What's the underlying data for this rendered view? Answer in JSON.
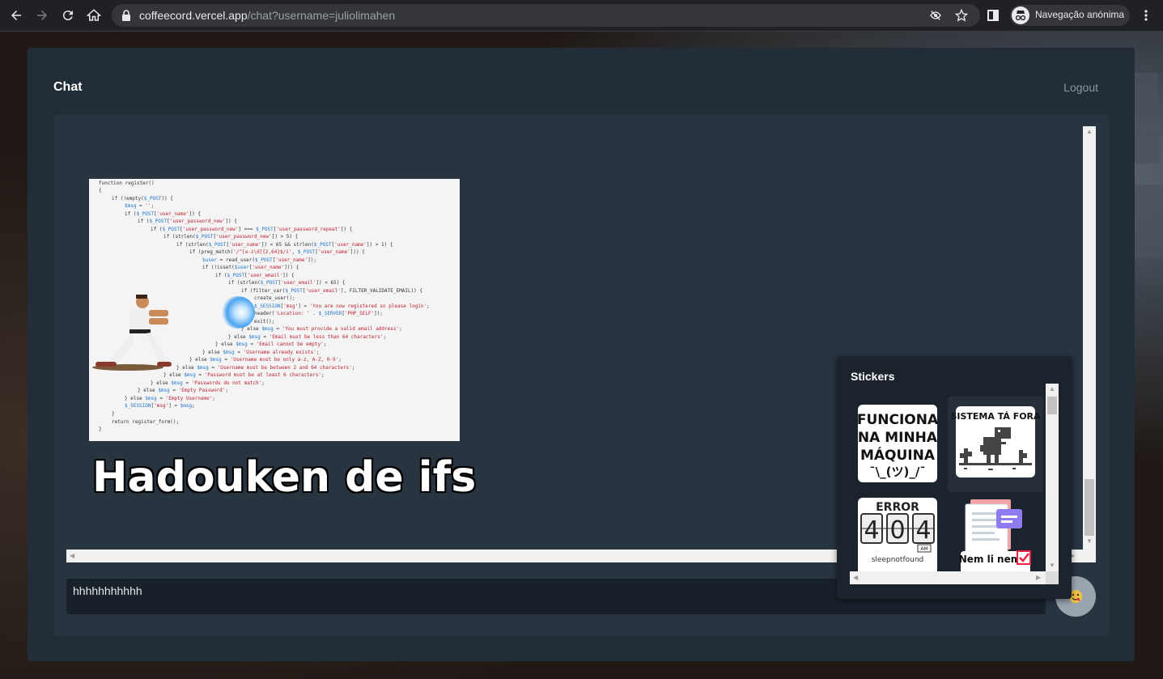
{
  "browser": {
    "url_host": "coffeecord.vercel.app",
    "url_path": "/chat?username=juliolimahen",
    "incognito_label": "Navegação anónima"
  },
  "app": {
    "title": "Chat",
    "logout_label": "Logout"
  },
  "messages": [
    {
      "type": "image",
      "caption": "Hadouken de ifs"
    }
  ],
  "composer": {
    "value": "hhhhhhhhhhh"
  },
  "stickers": {
    "title": "Stickers",
    "items": [
      {
        "name": "funciona-na-minha-maquina",
        "text": [
          "FUNCIONA",
          "NA MINHA",
          "MÁQUINA",
          "¯\\_(ツ)_/¯"
        ]
      },
      {
        "name": "sistema-ta-fora",
        "text": [
          "SISTEMA TÁ FORA"
        ]
      },
      {
        "name": "error-404",
        "text": [
          "ERROR",
          "4",
          "0",
          "4",
          "AM",
          "sleepnotfound"
        ]
      },
      {
        "name": "nem-li-nem",
        "text": [
          "Nem li nem"
        ]
      }
    ]
  },
  "colors": {
    "card": "#222d37",
    "panel": "#283440",
    "input": "#18212a",
    "popup": "#1b232c"
  }
}
